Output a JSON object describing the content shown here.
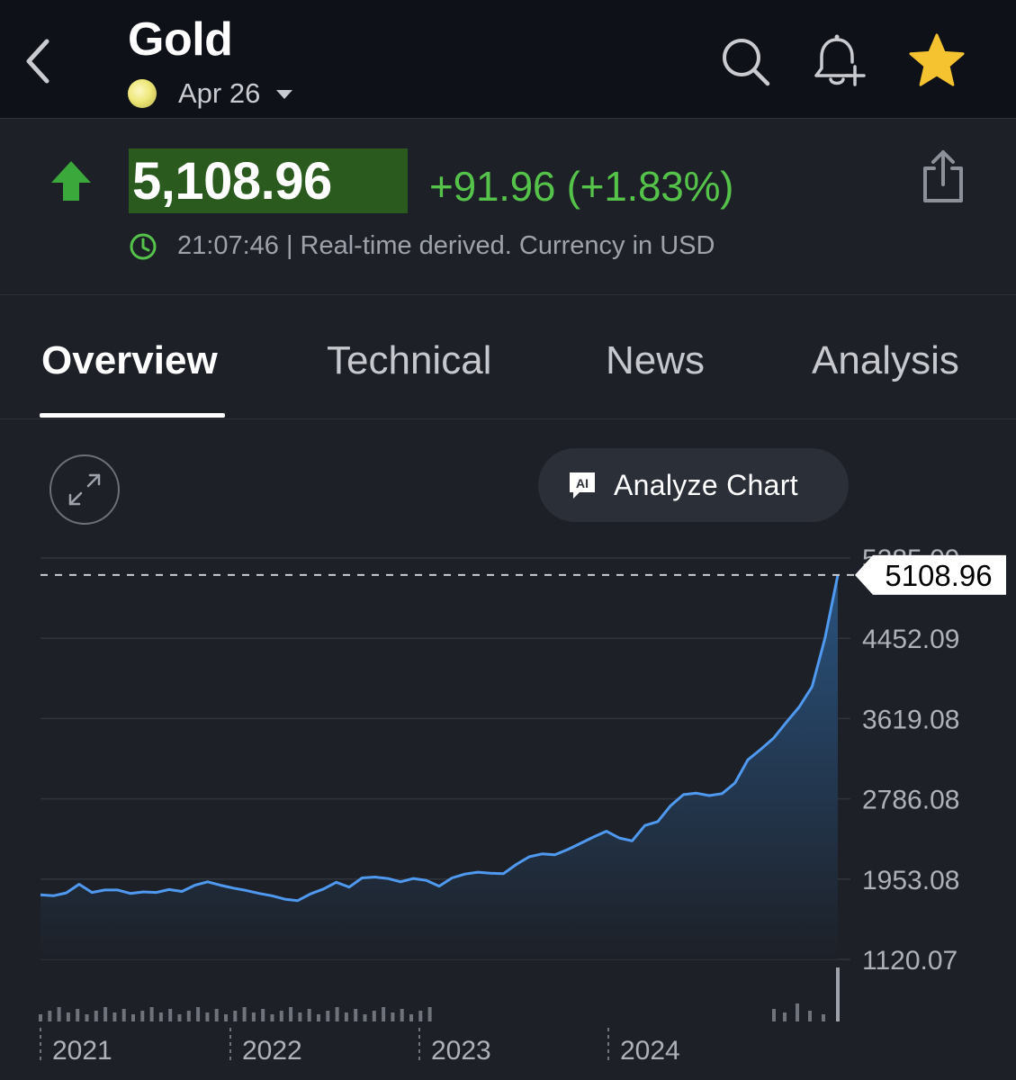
{
  "header": {
    "title": "Gold",
    "contract_label": "Apr 26",
    "icons": [
      "back-icon",
      "search-icon",
      "bell-plus-icon",
      "star-icon"
    ]
  },
  "quote": {
    "price": "5,108.96",
    "change": "+91.96 (+1.83%)",
    "meta": "21:07:46 | Real-time derived. Currency in USD",
    "direction": "up",
    "colors": {
      "up": "#55c24a",
      "price_highlight": "#2a5a1d"
    }
  },
  "tabs": [
    {
      "label": "Overview",
      "active": true
    },
    {
      "label": "Technical",
      "active": false
    },
    {
      "label": "News",
      "active": false
    },
    {
      "label": "Analysis",
      "active": false
    }
  ],
  "chart_controls": {
    "analyze_label": "Analyze Chart",
    "ai_badge": "AI"
  },
  "chart_data": {
    "type": "area",
    "y_ticks": [
      "5285.09",
      "4452.09",
      "3619.08",
      "2786.08",
      "1953.08",
      "1120.07"
    ],
    "y_tick_values": [
      5285.09,
      4452.09,
      3619.08,
      2786.08,
      1953.08,
      1120.07
    ],
    "ylim": [
      1120.07,
      5285.09
    ],
    "x_ticks": [
      "2021",
      "2022",
      "2023",
      "2024"
    ],
    "current_value_label": "5108.96",
    "current_value": 5108.96,
    "line_color": "#4f9af0",
    "series": [
      {
        "values": [
          1790,
          1780,
          1810,
          1900,
          1815,
          1840,
          1840,
          1805,
          1820,
          1815,
          1845,
          1825,
          1890,
          1925,
          1890,
          1860,
          1835,
          1805,
          1780,
          1745,
          1730,
          1800,
          1850,
          1920,
          1870,
          1965,
          1975,
          1960,
          1925,
          1960,
          1940,
          1880,
          1965,
          2005,
          2025,
          2015,
          2010,
          2105,
          2185,
          2215,
          2205,
          2260,
          2325,
          2390,
          2450,
          2380,
          2350,
          2510,
          2550,
          2715,
          2830,
          2845,
          2820,
          2840,
          2950,
          3190,
          3300,
          3415,
          3580,
          3740,
          3950,
          4451,
          5108.96
        ]
      }
    ]
  }
}
